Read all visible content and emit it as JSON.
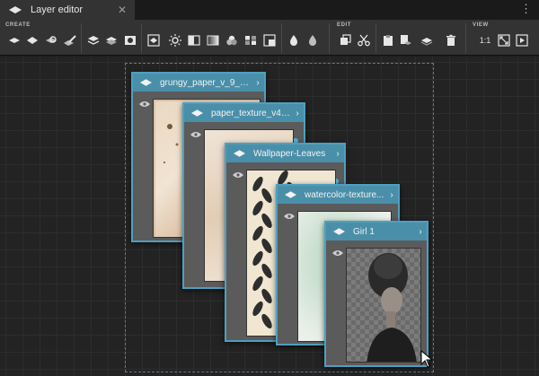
{
  "tab": {
    "title": "Layer editor",
    "close_glyph": "✕",
    "menu_glyph": "⋮"
  },
  "toolbar": {
    "sections": {
      "create": "CREATE",
      "edit": "EDIT",
      "view": "VIEW"
    },
    "zoom_label": "1:1"
  },
  "layers": [
    {
      "name": "grungy_paper_v_9_by...",
      "visible": true,
      "thumbnail": "paper-texture"
    },
    {
      "name": "paper_texture_v4_...",
      "visible": true,
      "thumbnail": "paper-texture"
    },
    {
      "name": "Wallpaper-Leaves",
      "visible": true,
      "thumbnail": "leaf-pattern"
    },
    {
      "name": "watercolor-texture...",
      "visible": true,
      "thumbnail": "watercolor"
    },
    {
      "name": "Girl 1",
      "visible": true,
      "thumbnail": "portrait"
    }
  ],
  "icons": {
    "layer": "layer-icon",
    "eye": "eye-icon",
    "chevron": "chevron-right-icon",
    "cursor": "mouse-pointer-icon"
  },
  "colors": {
    "accent": "#4f9fbe",
    "header": "#4a8fa9",
    "dot": "#4fb1d8"
  }
}
